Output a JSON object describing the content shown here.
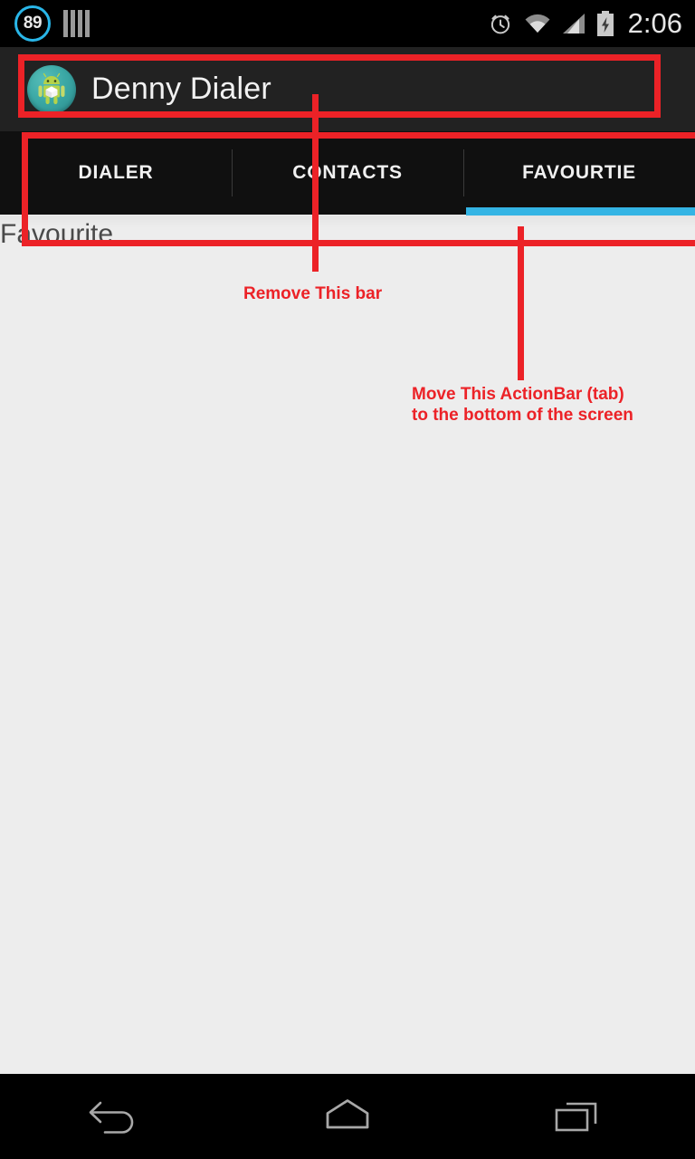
{
  "status_bar": {
    "badge": "89",
    "badge_color": "#29b6e8",
    "bars_icon": "signal-bars-icon",
    "alarm_icon": "alarm-clock-icon",
    "wifi_icon": "wifi-icon",
    "signal_icon": "cell-signal-icon",
    "battery_icon": "battery-charging-icon",
    "time": "2:06"
  },
  "action_bar": {
    "icon": "android-app-icon",
    "title": "Denny Dialer",
    "background": "#222222"
  },
  "tabs": {
    "items": [
      {
        "label": "DIALER",
        "selected": false
      },
      {
        "label": "CONTACTS",
        "selected": false
      },
      {
        "label": "FAVOURTIE",
        "selected": true
      }
    ],
    "indicator_color": "#34b4e4",
    "background": "#101010"
  },
  "content": {
    "heading": "Favourite",
    "background": "#ededed"
  },
  "annotations": {
    "color": "#ec2227",
    "note_1": "Remove This bar",
    "note_2": "Move This ActionBar (tab)\nto the bottom of the screen"
  },
  "nav_bar": {
    "back": "back-icon",
    "home": "home-icon",
    "recents": "recents-icon"
  }
}
